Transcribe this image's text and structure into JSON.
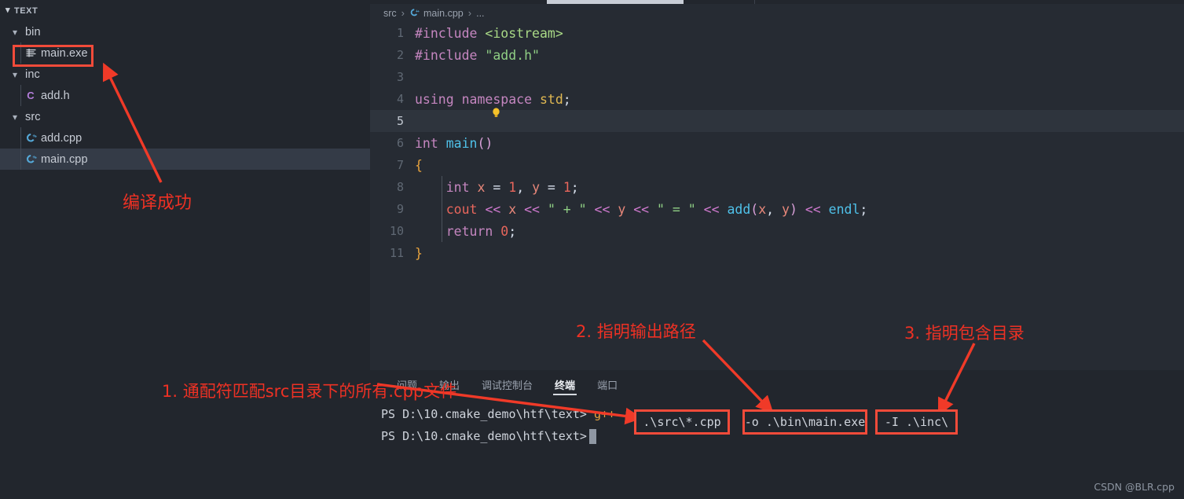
{
  "sidebar": {
    "header": "TEXT",
    "header_chevron": "chevron-down-icon",
    "items": [
      {
        "label": "bin",
        "type": "folder",
        "icon": "chevron-down-icon",
        "depth": 0,
        "selected": false
      },
      {
        "label": "main.exe",
        "type": "file",
        "icon": "exe-icon",
        "depth": 1,
        "selected": false
      },
      {
        "label": "inc",
        "type": "folder",
        "icon": "chevron-down-icon",
        "depth": 0,
        "selected": false
      },
      {
        "label": "add.h",
        "type": "file",
        "icon": "c-header-icon",
        "depth": 1,
        "selected": false
      },
      {
        "label": "src",
        "type": "folder",
        "icon": "chevron-down-icon",
        "depth": 0,
        "selected": false
      },
      {
        "label": "add.cpp",
        "type": "file",
        "icon": "cpp-icon",
        "depth": 1,
        "selected": false
      },
      {
        "label": "main.cpp",
        "type": "file",
        "icon": "cpp-icon",
        "depth": 1,
        "selected": true
      }
    ]
  },
  "editor": {
    "breadcrumb": {
      "folder": "src",
      "file": "main.cpp",
      "more": "...",
      "file_icon": "cpp-icon",
      "separator": "›"
    },
    "active_line": 5,
    "lightbulb_line": 4,
    "lines": [
      {
        "n": "1",
        "text": "#include <iostream>"
      },
      {
        "n": "2",
        "text": "#include \"add.h\""
      },
      {
        "n": "3",
        "text": ""
      },
      {
        "n": "4",
        "text": "using namespace std;"
      },
      {
        "n": "5",
        "text": ""
      },
      {
        "n": "6",
        "text": "int main()"
      },
      {
        "n": "7",
        "text": "{"
      },
      {
        "n": "8",
        "text": "    int x = 1, y = 1;"
      },
      {
        "n": "9",
        "text": "    cout << x << \" + \" << y << \" = \" << add(x, y) << endl;"
      },
      {
        "n": "10",
        "text": "    return 0;"
      },
      {
        "n": "11",
        "text": "}"
      }
    ]
  },
  "panel": {
    "tabs": [
      {
        "label": "问题",
        "active": false
      },
      {
        "label": "输出",
        "active": false
      },
      {
        "label": "调试控制台",
        "active": false
      },
      {
        "label": "终端",
        "active": true
      },
      {
        "label": "端口",
        "active": false
      }
    ],
    "terminal": {
      "prompt": "PS D:\\10.cmake_demo\\htf\\text>",
      "command": "g++",
      "prompt2": "PS D:\\10.cmake_demo\\htf\\text>",
      "segments": [
        {
          "text": ".\\src\\*.cpp",
          "name": "cmd-segment-source-glob"
        },
        {
          "text": "-o .\\bin\\main.exe",
          "name": "cmd-segment-output-path"
        },
        {
          "text": "-I .\\inc\\",
          "name": "cmd-segment-include-dir"
        }
      ]
    }
  },
  "annotations": {
    "compile_success": "编译成功",
    "note1": "1. 通配符匹配src目录下的所有.cpp文件",
    "note2": "2. 指明输出路径",
    "note3": "3. 指明包含目录",
    "color": "#ee3124"
  },
  "watermark": "CSDN @BLR.cpp",
  "colors": {
    "sidebar_bg": "#22262d",
    "editor_bg": "#262b33",
    "annotation_red": "#ee3124",
    "box_red": "#f24b3a",
    "selected_row": "#343b47",
    "active_line": "#2e343d"
  }
}
